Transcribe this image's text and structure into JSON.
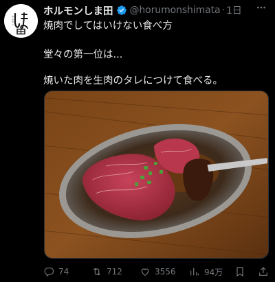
{
  "post": {
    "author_name": "ホルモンしま田",
    "handle": "@horumonshimata",
    "separator": "·",
    "time": "1日",
    "lines": [
      "焼肉でしてはいけない食べ方",
      "堂々の第一位は...",
      "焼いた肉を生肉のタレにつけて食べる。"
    ],
    "avatar_logo_text": "しま田"
  },
  "actions": {
    "reply_count": "74",
    "repost_count": "712",
    "like_count": "3556",
    "view_count": "94万"
  },
  "icons": {
    "verified": "verified-badge-icon",
    "more": "more-icon",
    "reply": "reply-icon",
    "repost": "repost-icon",
    "like": "heart-icon",
    "views": "views-icon",
    "bookmark": "bookmark-icon",
    "share": "share-icon"
  },
  "colors": {
    "background": "#000000",
    "text": "#e7e9ea",
    "muted": "#71767b",
    "verified": "#1d9bf0"
  }
}
